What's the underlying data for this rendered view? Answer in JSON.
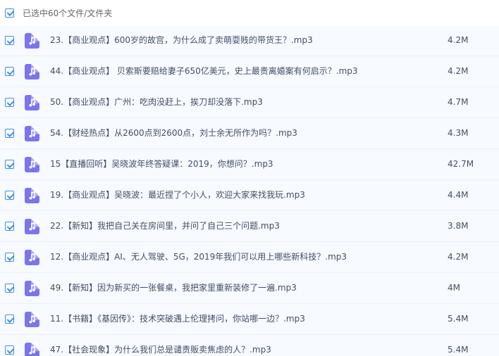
{
  "header": {
    "select_all_label": "已选中60个文件/文件夹"
  },
  "colors": {
    "accent": "#3c8cf0",
    "music_icon": "#7b74ee",
    "row_background": "#f7faff",
    "text": "#424e67"
  },
  "files": [
    {
      "name": "23.【商业观点】600岁的故宫，为什么成了卖萌耍贱的带货王？.mp3",
      "size": "4.2M",
      "icon": "music-file-icon"
    },
    {
      "name": "44.【商业观点】 贝索斯要赔给妻子650亿美元，史上最贵离婚案有何启示？.mp3",
      "size": "4.2M",
      "icon": "music-file-icon"
    },
    {
      "name": "50.【商业观点】广州：吃肉没赶上，挨刀却没落下.mp3",
      "size": "4.7M",
      "icon": "music-file-icon"
    },
    {
      "name": "54.【财经热点】从2600点到2600点，刘士余无所作为吗？.mp3",
      "size": "4.3M",
      "icon": "music-file-icon"
    },
    {
      "name": "15【直播回听】吴晓波年终答疑课：2019，你想问？.mp3",
      "size": "42.7M",
      "icon": "music-file-icon"
    },
    {
      "name": "19.【商业观点】吴晓波：最近捏了个小人，欢迎大家来找我玩.mp3",
      "size": "4.4M",
      "icon": "music-file-icon"
    },
    {
      "name": "22.【新知】我把自己关在房间里，并问了自己三个问题.mp3",
      "size": "3.8M",
      "icon": "music-file-icon"
    },
    {
      "name": "12.【商业观点】AI、无人驾驶、5G，2019年我们可以用上哪些新科技？.mp3",
      "size": "4.2M",
      "icon": "music-file-icon"
    },
    {
      "name": "49.【新知】因为新买的一张餐桌，我把家里重新装修了一遍.mp3",
      "size": "4M",
      "icon": "music-file-icon"
    },
    {
      "name": "11.【书籍】《基因传》：技术突破遇上伦理拷问，你站哪一边？.mp3",
      "size": "5.4M",
      "icon": "music-file-icon"
    },
    {
      "name": "47.【社会现象】为什么我们总是谴责贩卖焦虑的人？.mp3",
      "size": "5.4M",
      "icon": "music-file-icon"
    }
  ]
}
